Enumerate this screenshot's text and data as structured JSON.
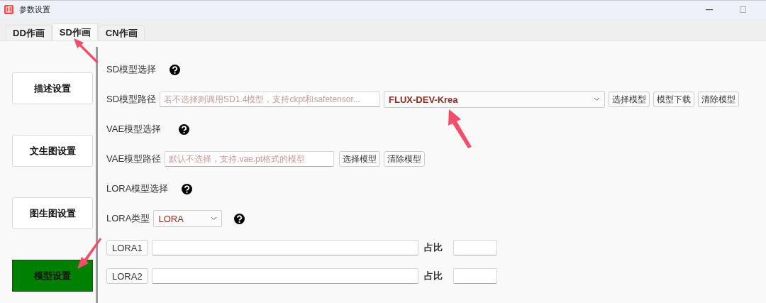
{
  "window": {
    "title": "参数设置"
  },
  "tabs": [
    {
      "label": "DD作画",
      "selected": false
    },
    {
      "label": "SD作画",
      "selected": true
    },
    {
      "label": "CN作画",
      "selected": false
    }
  ],
  "sidebar": {
    "items": [
      {
        "label": "描述设置",
        "selected": false
      },
      {
        "label": "文生图设置",
        "selected": false
      },
      {
        "label": "图生图设置",
        "selected": false
      },
      {
        "label": "模型设置",
        "selected": true
      }
    ]
  },
  "sd_model": {
    "heading": "SD模型选择",
    "path_label": "SD模型路径",
    "path_placeholder": "若不选择则调用SD1.4模型，支持ckpt和safetensor...",
    "model_value": "FLUX-DEV-Krea",
    "buttons": [
      "选择模型",
      "模型下载",
      "清除模型"
    ]
  },
  "vae_model": {
    "heading": "VAE模型选择",
    "path_label": "VAE模型路径",
    "path_placeholder": "默认不选择，支持.vae.pt格式的模型",
    "buttons": [
      "选择模型",
      "清除模型"
    ]
  },
  "lora": {
    "heading": "LORA模型选择",
    "type_label": "LORA类型",
    "type_value": "LORA",
    "slots": [
      {
        "label": "LORA1",
        "ratio_label": "占比"
      },
      {
        "label": "LORA2",
        "ratio_label": "占比"
      }
    ]
  }
}
